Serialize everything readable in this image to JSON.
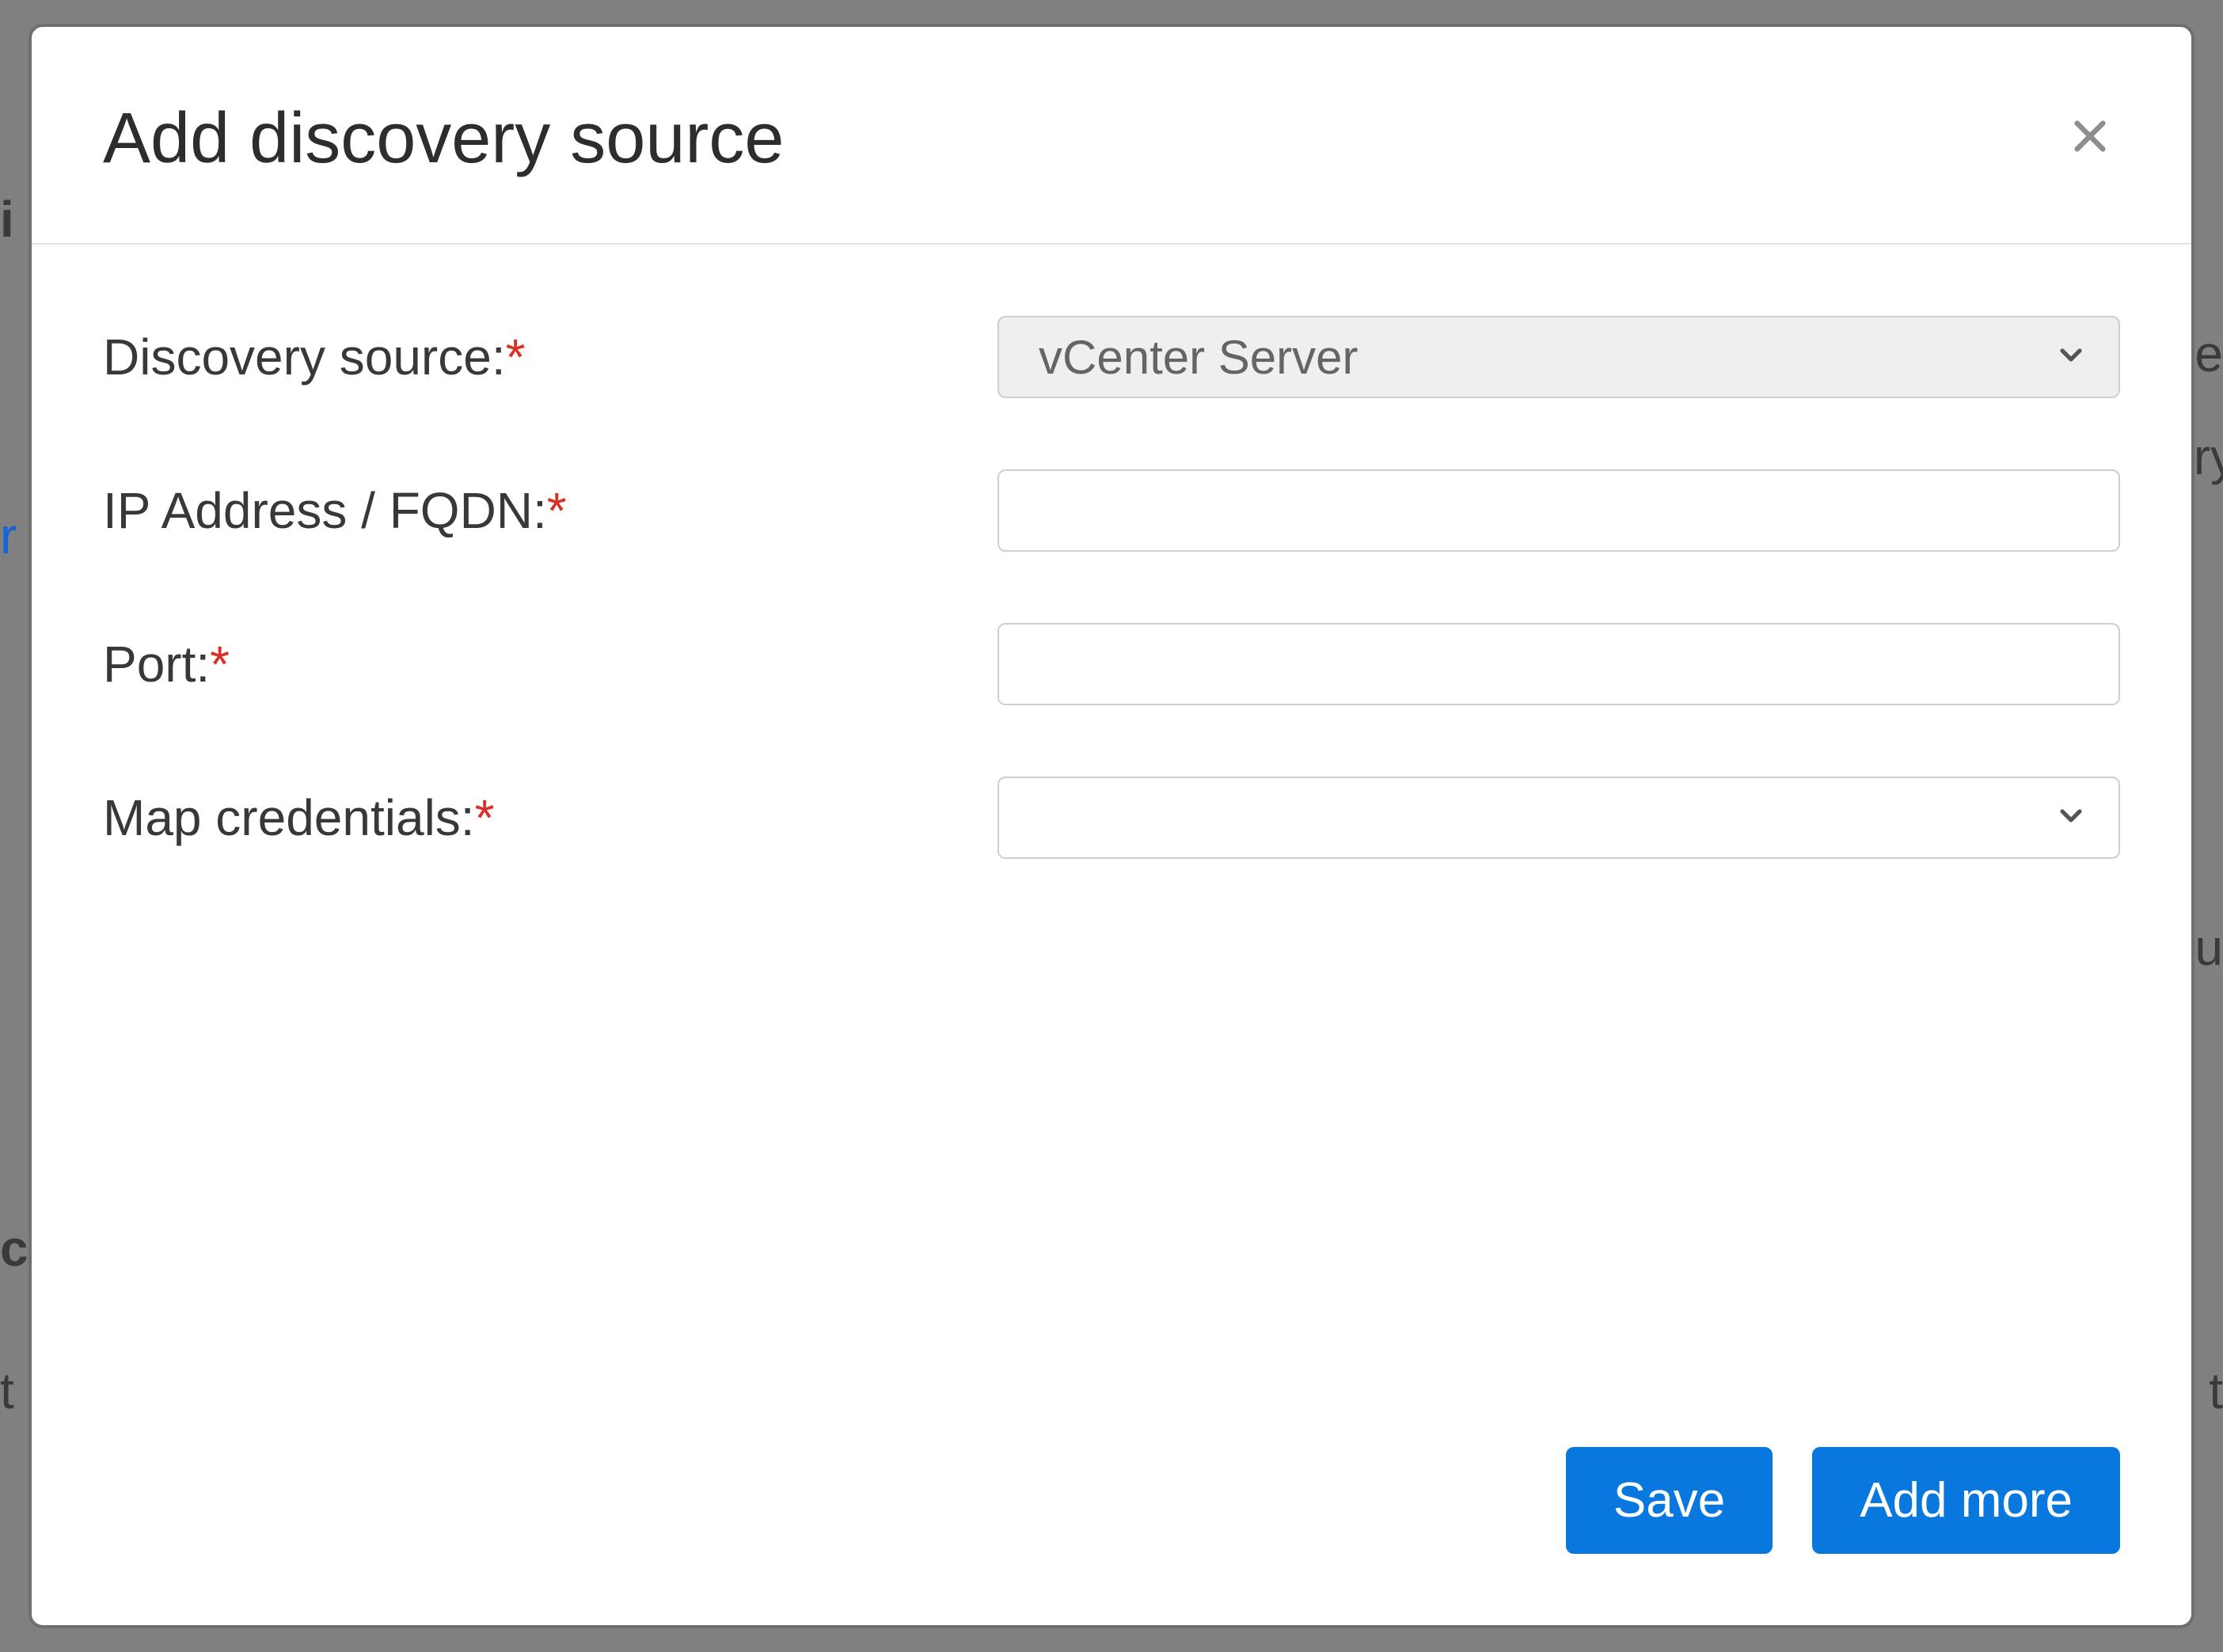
{
  "modal": {
    "title": "Add discovery source",
    "close_aria": "Close",
    "fields": {
      "discovery_source": {
        "label": "Discovery source:",
        "required": "*",
        "value": "vCenter Server"
      },
      "ip_fqdn": {
        "label": "IP Address / FQDN:",
        "required": "*",
        "value": ""
      },
      "port": {
        "label": "Port:",
        "required": "*",
        "value": ""
      },
      "map_credentials": {
        "label": "Map credentials:",
        "required": "*",
        "value": ""
      }
    },
    "buttons": {
      "save": "Save",
      "add_more": "Add more"
    }
  },
  "backdrop": {
    "frag1": "i",
    "frag2": "e",
    "frag3": "ry",
    "frag4": "r",
    "frag5": "u",
    "frag6": "c",
    "frag7": "t",
    "frag8_left": "t"
  }
}
